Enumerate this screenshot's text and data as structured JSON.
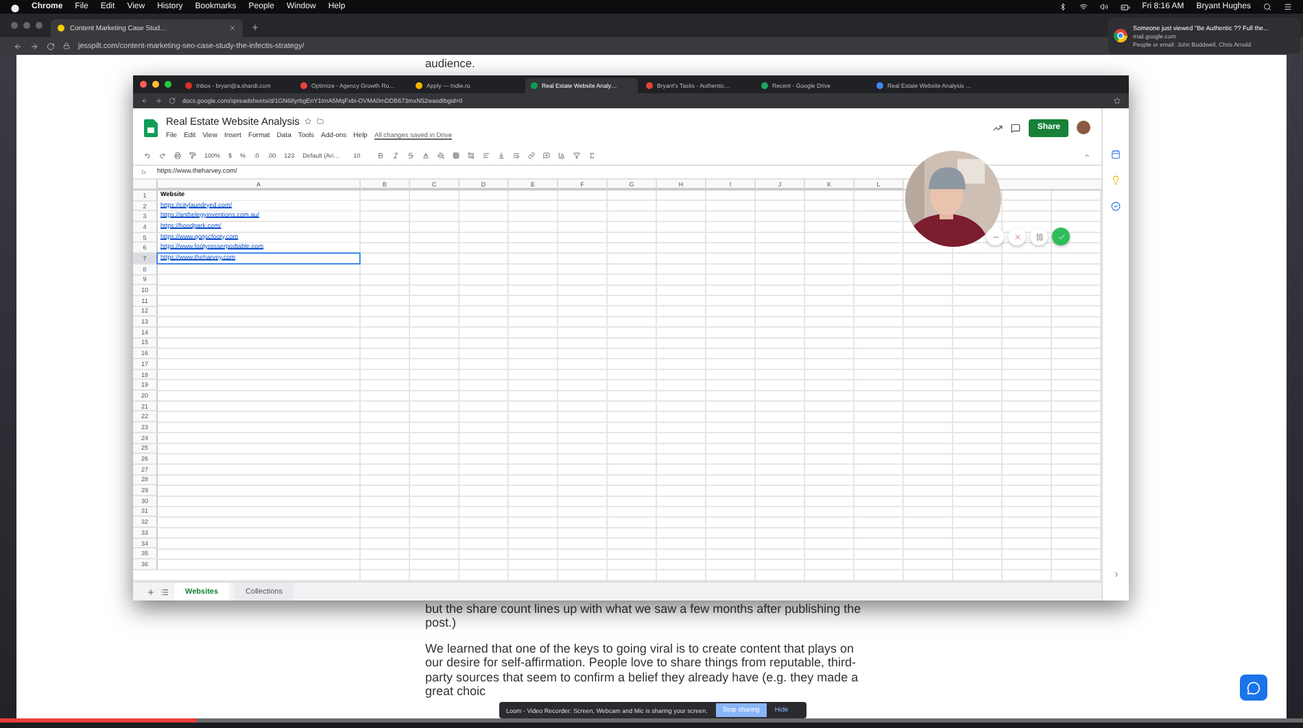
{
  "menu_bar": {
    "app": "Chrome",
    "items": [
      "File",
      "Edit",
      "View",
      "History",
      "Bookmarks",
      "People",
      "Window",
      "Help"
    ],
    "clock": "Fri 8:16 AM",
    "user": "Bryant Hughes"
  },
  "browser": {
    "tab": "Content Marketing Case Stud…",
    "url": "jesspilt.com/content-marketing-seo-case-study-the-infectis-strategy/"
  },
  "notification": {
    "title": "Someone just viewed \"Be Authentic ?? Full the...",
    "source": "mail.google.com",
    "detail": "People or email: John Buddwell, Chris Arnold"
  },
  "article": {
    "top_line": "audience.",
    "paragraphs": [
      "but the share count lines up with what we saw a few months after publishing the post.)",
      "We learned that one of the keys to going viral is to create content that plays on our desire for self-affirmation. People love to share things from reputable, third-party sources that seem to confirm a belief they already have (e.g. they made a great choic"
    ]
  },
  "shared_window": {
    "tabs": [
      {
        "title": "Inbox - bryan@a.shardt.com",
        "selected": false,
        "color": "#d93025"
      },
      {
        "title": "Optimize - Agency Growth Ro…",
        "selected": false,
        "color": "#e8453c"
      },
      {
        "title": "Apply — Indie.ro",
        "selected": false,
        "color": "#f4b400"
      },
      {
        "title": "Real Estate Website Analy…",
        "selected": true,
        "color": "#0f9d58"
      },
      {
        "title": "Bryant's Tasks - Authentic…",
        "selected": false,
        "color": "#e44332"
      },
      {
        "title": "Recent - Google Drive",
        "selected": false,
        "color": "#1fa463"
      },
      {
        "title": "Real Estate Website Analysis …",
        "selected": false,
        "color": "#4285f4"
      }
    ],
    "url": "docs.google.com/spreadsheets/d/1GN68yrbgEnY1tmA5MqFxbi-OVMA0mDDB673mxN52wasdtbgid=0",
    "doc_title": "Real Estate Website Analysis",
    "menu": [
      "File",
      "Edit",
      "View",
      "Insert",
      "Format",
      "Data",
      "Tools",
      "Add-ons",
      "Help"
    ],
    "save_status": "All changes saved in Drive",
    "share": "Share",
    "toolbar": {
      "zoom": "100%",
      "currency": "$",
      "percent": "%",
      "decimal_less": ".0",
      "decimal_more": ".00",
      "number_format": "123",
      "font": "Default (Ari…",
      "font_size": "10"
    },
    "formula_label": "fx",
    "formula": "https://www.theharvey.com/",
    "columns": [
      "A",
      "B",
      "C",
      "D",
      "E",
      "F",
      "G",
      "H",
      "I",
      "J",
      "K",
      "L"
    ],
    "rows": [
      {
        "number": "1",
        "cell": "Website",
        "kind": "header",
        "selected": false
      },
      {
        "number": "2",
        "cell": "https://citylaundryed.com/",
        "kind": "link",
        "selected": false
      },
      {
        "number": "3",
        "cell": "https://anthelegyinventions.com.au/",
        "kind": "link",
        "selected": false
      },
      {
        "number": "4",
        "cell": "https://hoodpark.com/",
        "kind": "link",
        "selected": false
      },
      {
        "number": "5",
        "cell": "https://www.gogscfooty.com",
        "kind": "link",
        "selected": false
      },
      {
        "number": "6",
        "cell": "https://www.footyrosserpodtable.com",
        "kind": "link",
        "selected": false
      },
      {
        "number": "7",
        "cell": "https://www.theharvey.com",
        "kind": "link",
        "selected": true
      },
      {
        "number": "8",
        "selected": false
      },
      {
        "number": "9",
        "selected": false
      },
      {
        "number": "10",
        "selected": false
      },
      {
        "number": "11",
        "selected": false
      },
      {
        "number": "12",
        "selected": false
      },
      {
        "number": "13",
        "selected": false
      },
      {
        "number": "14",
        "selected": false
      },
      {
        "number": "15",
        "selected": false
      },
      {
        "number": "16",
        "selected": false
      },
      {
        "number": "17",
        "selected": false
      },
      {
        "number": "18",
        "selected": false
      },
      {
        "number": "19",
        "selected": false
      },
      {
        "number": "20",
        "selected": false
      },
      {
        "number": "21",
        "selected": false
      },
      {
        "number": "22",
        "selected": false
      },
      {
        "number": "23",
        "selected": false
      },
      {
        "number": "24",
        "selected": false
      },
      {
        "number": "25",
        "selected": false
      },
      {
        "number": "26",
        "selected": false
      },
      {
        "number": "27",
        "selected": false
      },
      {
        "number": "28",
        "selected": false
      },
      {
        "number": "29",
        "selected": false
      },
      {
        "number": "30",
        "selected": false
      },
      {
        "number": "31",
        "selected": false
      },
      {
        "number": "32",
        "selected": false
      },
      {
        "number": "33",
        "selected": false
      },
      {
        "number": "34",
        "selected": false
      },
      {
        "number": "35",
        "selected": false
      },
      {
        "number": "36",
        "selected": false
      }
    ],
    "sheets": [
      {
        "name": "Websites",
        "selected": true
      },
      {
        "name": "Collections",
        "selected": false
      }
    ]
  },
  "recorder": {
    "message": "Loom - Video Recorder: Screen, Webcam and Mic is sharing your screen.",
    "stop": "Stop sharing",
    "hide": "Hide"
  },
  "video_progress": {
    "level": 0.15
  }
}
